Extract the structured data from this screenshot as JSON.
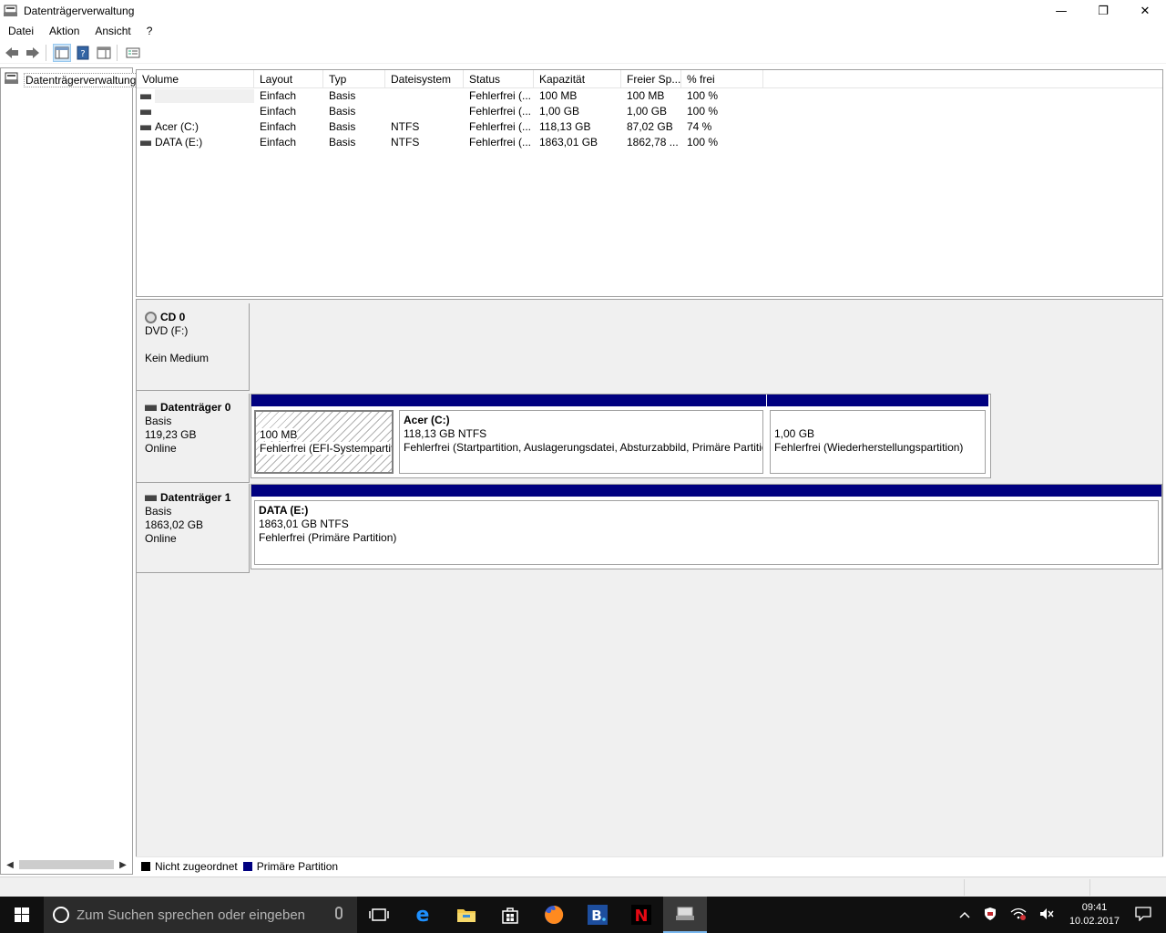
{
  "window": {
    "title": "Datenträgerverwaltung",
    "minimize": "—",
    "restore": "❐",
    "close": "✕"
  },
  "menu": [
    "Datei",
    "Aktion",
    "Ansicht",
    "?"
  ],
  "tree": {
    "root_label": "Datenträgerverwaltung"
  },
  "volume_table": {
    "columns": [
      "Volume",
      "Layout",
      "Typ",
      "Dateisystem",
      "Status",
      "Kapazität",
      "Freier Sp...",
      "% frei"
    ],
    "rows": [
      {
        "volume": "",
        "layout": "Einfach",
        "typ": "Basis",
        "fs": "",
        "status": "Fehlerfrei (...",
        "cap": "100 MB",
        "free": "100 MB",
        "pct": "100 %"
      },
      {
        "volume": "",
        "layout": "Einfach",
        "typ": "Basis",
        "fs": "",
        "status": "Fehlerfrei (...",
        "cap": "1,00 GB",
        "free": "1,00 GB",
        "pct": "100 %"
      },
      {
        "volume": "Acer (C:)",
        "layout": "Einfach",
        "typ": "Basis",
        "fs": "NTFS",
        "status": "Fehlerfrei (...",
        "cap": "118,13 GB",
        "free": "87,02 GB",
        "pct": "74 %"
      },
      {
        "volume": "DATA (E:)",
        "layout": "Einfach",
        "typ": "Basis",
        "fs": "NTFS",
        "status": "Fehlerfrei (...",
        "cap": "1863,01 GB",
        "free": "1862,78 ...",
        "pct": "100 %"
      }
    ]
  },
  "disks": {
    "cd0": {
      "name": "CD 0",
      "line1": "DVD (F:)",
      "line2": "Kein Medium"
    },
    "disk0": {
      "name": "Datenträger 0",
      "type": "Basis",
      "size": "119,23 GB",
      "state": "Online",
      "partitions": [
        {
          "title": "",
          "size": "100 MB",
          "status": "Fehlerfrei (EFI-Systempartition)"
        },
        {
          "title": "Acer  (C:)",
          "size": "118,13 GB NTFS",
          "status": "Fehlerfrei (Startpartition, Auslagerungsdatei, Absturzabbild, Primäre Partition)"
        },
        {
          "title": "",
          "size": "1,00 GB",
          "status": "Fehlerfrei (Wiederherstellungspartition)"
        }
      ]
    },
    "disk1": {
      "name": "Datenträger 1",
      "type": "Basis",
      "size": "1863,02 GB",
      "state": "Online",
      "partitions": [
        {
          "title": "DATA  (E:)",
          "size": "1863,01 GB NTFS",
          "status": "Fehlerfrei (Primäre Partition)"
        }
      ]
    }
  },
  "legend": [
    {
      "label": "Nicht zugeordnet",
      "color": "#000000"
    },
    {
      "label": "Primäre Partition",
      "color": "#000080"
    }
  ],
  "taskbar": {
    "search_placeholder": "Zum Suchen sprechen oder eingeben",
    "time": "09:41",
    "date": "10.02.2017"
  },
  "colors": {
    "primary_partition": "#000080",
    "taskbar": "#101010"
  }
}
